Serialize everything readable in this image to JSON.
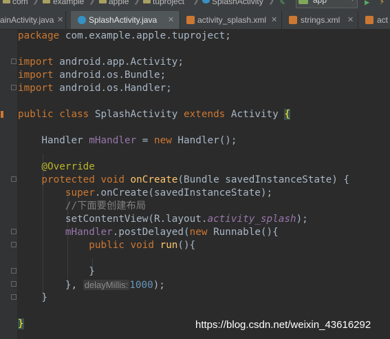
{
  "breadcrumbs": [
    "com",
    "example",
    "apple",
    "tuproject",
    "SplashActivity"
  ],
  "run_config": {
    "label": "app"
  },
  "tabs": [
    {
      "label": "ainActivity.java",
      "icon": "class-icon"
    },
    {
      "label": "SplashActivity.java",
      "icon": "class-icon"
    },
    {
      "label": "activity_splash.xml",
      "icon": "xml-icon"
    },
    {
      "label": "strings.xml",
      "icon": "xml-icon"
    },
    {
      "label": "act",
      "icon": "xml-icon"
    }
  ],
  "code": {
    "pkg": {
      "kw": "package",
      "text": " com.example.apple.tuproject;"
    },
    "imports": [
      {
        "kw": "import",
        "text": " android.app.Activity;"
      },
      {
        "kw": "import",
        "text": " android.os.Bundle;"
      },
      {
        "kw": "import",
        "text": " android.os.Handler;"
      }
    ],
    "class_line": {
      "kw1": "public class",
      "name": " SplashActivity ",
      "kw2": "extends",
      "parent": " Activity ",
      "brace": "{"
    },
    "field_line": {
      "type": "    Handler ",
      "name": "mHandler",
      "eq": " = ",
      "kw": "new",
      "rest": " Handler();"
    },
    "annotation": "    @Override",
    "method_line": {
      "kw": "    protected void ",
      "name": "onCreate",
      "rest": "(Bundle savedInstanceState) {"
    },
    "super_line": {
      "kw": "        super",
      "rest": ".onCreate(savedInstanceState);"
    },
    "comment": "        //下面要创建布局",
    "setcontent_line": {
      "pre": "        setContentView(R.layout.",
      "field": "activity_splash",
      "post": ");"
    },
    "post_line": {
      "field": "        mHandler",
      "mid": ".postDelayed(",
      "kw": "new",
      "rest": " Runnable(){"
    },
    "run_line": {
      "kw": "            public void ",
      "name": "run",
      "rest": "(){"
    },
    "run_close": "            }",
    "post_close": {
      "pre": "        }, ",
      "hint": "delayMillis:",
      "num": "1000",
      "post": ");"
    },
    "method_close": "    }",
    "class_close": "}"
  },
  "watermark": "https://blog.csdn.net/weixin_43616292"
}
